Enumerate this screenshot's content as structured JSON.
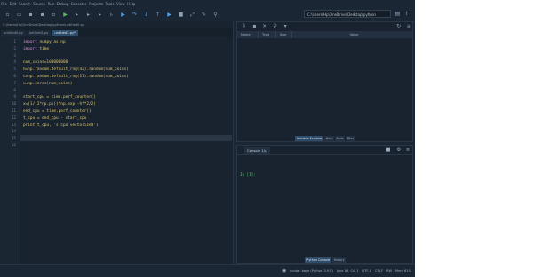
{
  "menubar": {
    "items": [
      "File",
      "Edit",
      "Search",
      "Source",
      "Run",
      "Debug",
      "Consoles",
      "Projects",
      "Tools",
      "View",
      "Help"
    ]
  },
  "toolbar": {
    "icons": [
      "new-file-icon",
      "open-file-icon",
      "save-icon",
      "save-all-icon",
      "new-cell-icon",
      "run-icon",
      "run-file-icon",
      "run-cell-icon",
      "run-cell-advance-icon",
      "run-selection-icon",
      "debug-icon",
      "debug-step-icon",
      "debug-into-icon",
      "debug-return-icon",
      "debug-continue-icon",
      "stop-icon",
      "maximize-icon",
      "settings-icon",
      "python-path-icon"
    ],
    "path": "C:\\Users\\Hp\\OneDrive\\Desktop\\python"
  },
  "editor": {
    "path": "C:\\Users\\Hp\\OneDrive\\Desktop\\python\\untitled0.py",
    "tabs": [
      {
        "label": "untitled0.py",
        "active": false
      },
      {
        "label": "untitled1.py",
        "active": false
      },
      {
        "label": "untitled2.py*",
        "active": true
      }
    ],
    "lines": [
      {
        "n": "1",
        "kw": "import",
        "rest": " numpy as np"
      },
      {
        "n": "2",
        "kw": "import",
        "rest": " time"
      },
      {
        "n": "3",
        "kw": "",
        "rest": ""
      },
      {
        "n": "4",
        "kw": "",
        "rest": "num_coins=100000000"
      },
      {
        "n": "5",
        "kw": "",
        "rest": "h=np.random.default_rng(42).random(num_coins)"
      },
      {
        "n": "6",
        "kw": "",
        "rest": "c=np.random.default_rng(17).random(num_coins)"
      },
      {
        "n": "7",
        "kw": "",
        "rest": "x=np.zeros(num_coins)"
      },
      {
        "n": "8",
        "kw": "",
        "rest": ""
      },
      {
        "n": "9",
        "kw": "",
        "rest": "start_cpu = time.perf_counter()"
      },
      {
        "n": "10",
        "kw": "",
        "rest": "x=(1/(2*np.pi))*np.exp(-h**2/2)"
      },
      {
        "n": "11",
        "kw": "",
        "rest": "end_cpu = time.perf_counter()"
      },
      {
        "n": "12",
        "kw": "",
        "rest": "t_cpu = end_cpu - start_cpu"
      },
      {
        "n": "13",
        "kw": "",
        "rest": "print(t_cpu, 's cpu vectorized')"
      },
      {
        "n": "14",
        "kw": "",
        "rest": ""
      },
      {
        "n": "15",
        "kw": "",
        "rest": ""
      },
      {
        "n": "16",
        "kw": "",
        "rest": ""
      }
    ]
  },
  "variable_explorer": {
    "columns": [
      "Name",
      "Type",
      "Size",
      "Value"
    ],
    "tabs": [
      {
        "label": "Variable Explorer",
        "active": true
      },
      {
        "label": "Help",
        "active": false
      },
      {
        "label": "Plots",
        "active": false
      },
      {
        "label": "Files",
        "active": false
      }
    ]
  },
  "console": {
    "tab_label": "Console 1/A",
    "prompt": "In [1]:",
    "tabs": [
      {
        "label": "IPython Console",
        "active": true
      },
      {
        "label": "History",
        "active": false
      }
    ]
  },
  "statusbar": {
    "items": [
      "conda: base (Python 3.9.7)",
      "Line 16, Col 1",
      "UTF-8",
      "CRLF",
      "RW",
      "Mem 61%"
    ]
  },
  "colors": {
    "background": "#1b2635",
    "editor_bg": "#19232f",
    "keyword": "#d28bd6",
    "code_text": "#d9c46a",
    "prompt": "#4fd35b"
  }
}
